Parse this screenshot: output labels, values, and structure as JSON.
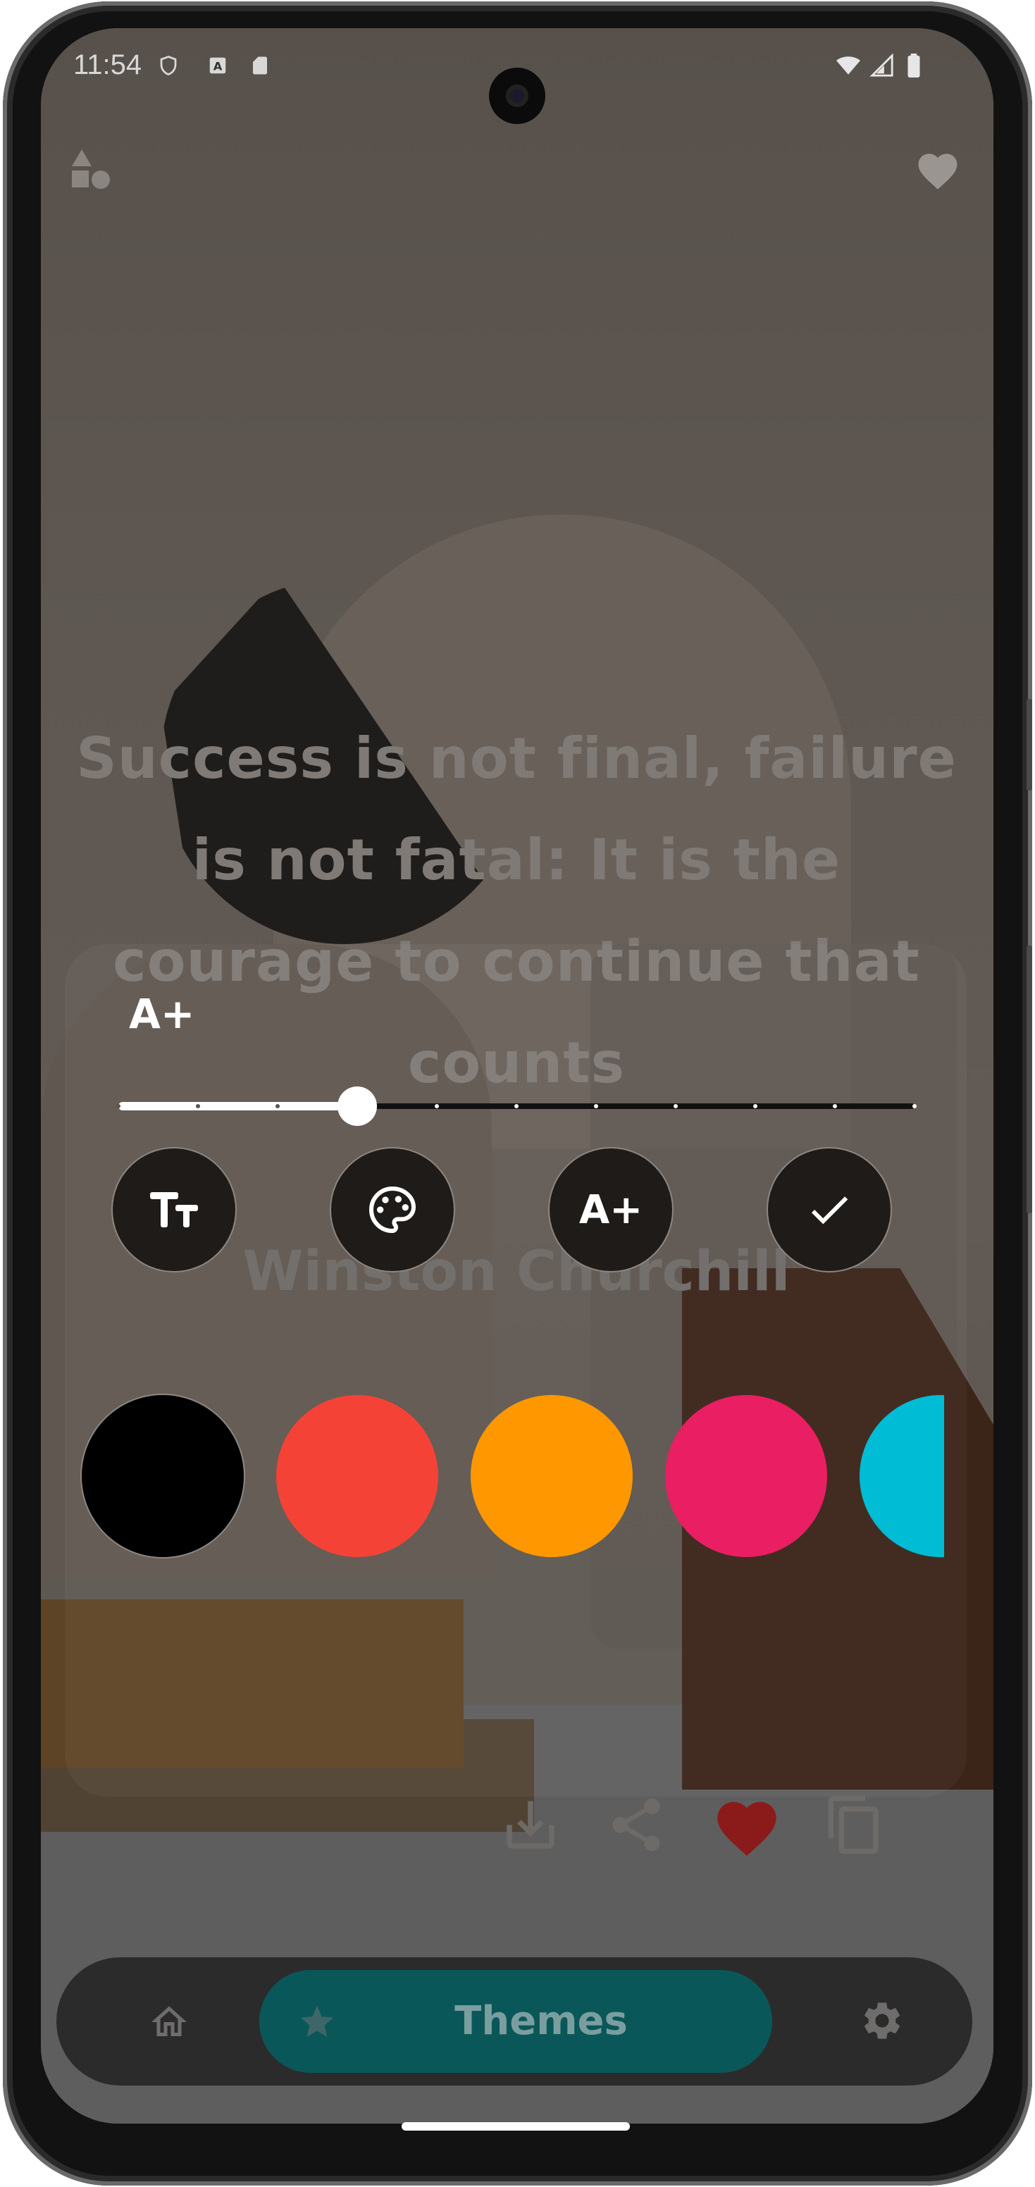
{
  "status_bar": {
    "time": "11:54",
    "left_icons": [
      "shield-icon",
      "a-badge-icon",
      "sd-card-icon"
    ],
    "right_icons": [
      "wifi-icon",
      "signal-icon",
      "battery-icon"
    ]
  },
  "top_bar": {
    "left_icon": "shapes-icon",
    "right_icon": "heart-icon"
  },
  "quote": {
    "text_lines": [
      "Success is not final, failure",
      "is not fatal: It is the",
      "courage to continue that",
      "counts"
    ],
    "author": "Winston Churchill"
  },
  "editor": {
    "font_size_label": "A+",
    "slider": {
      "steps": 11,
      "value_step": 3
    },
    "tools": [
      {
        "name": "text-style-button",
        "icon": "text-fields-icon",
        "label": "Tт"
      },
      {
        "name": "color-palette-button",
        "icon": "palette-icon",
        "label": ""
      },
      {
        "name": "font-size-button",
        "icon": "font-size-icon",
        "label": "A+"
      },
      {
        "name": "confirm-button",
        "icon": "check-icon",
        "label": ""
      }
    ],
    "colors": [
      "#000000",
      "#f44336",
      "#ff9800",
      "#e91e63",
      "#00bcd4"
    ]
  },
  "actions": [
    "download-icon",
    "share-icon",
    "heart-icon",
    "copy-icon"
  ],
  "accent_colors": {
    "heart": "#8b1a1a",
    "nav_pill": "#0a5759"
  },
  "bottom_nav": {
    "home_icon": "home-icon",
    "active_label": "Themes",
    "active_icon": "star-icon",
    "settings_icon": "gear-icon"
  }
}
